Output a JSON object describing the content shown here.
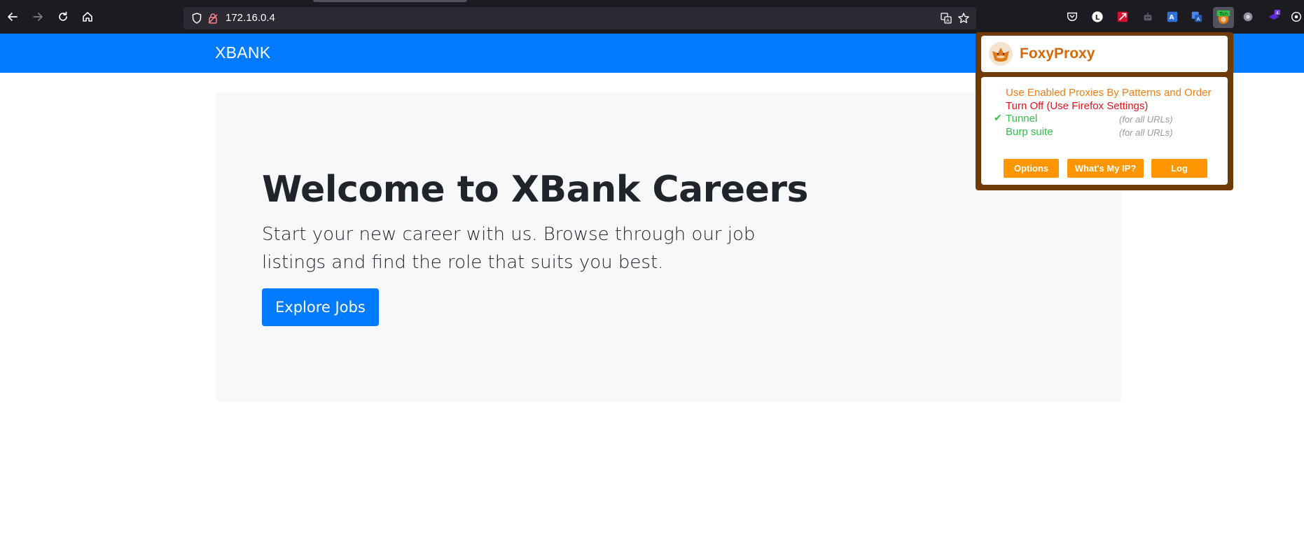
{
  "browser": {
    "url": "172.16.0.4",
    "nav": [
      "back",
      "forward",
      "reload",
      "home"
    ],
    "extension_badges": {
      "foxyproxy": "Tun",
      "notifications": "4"
    },
    "extension_icons": [
      "pocket-icon",
      "l-extension-icon",
      "red-extension-icon",
      "robot-icon",
      "translate-icon",
      "translate-alt-icon",
      "foxyproxy-icon",
      "grey-circle-icon",
      "purple-extension-icon",
      "puzzle-icon"
    ]
  },
  "navbar": {
    "brand": "XBANK"
  },
  "hero": {
    "title": "Welcome to XBank Careers",
    "lead": "Start your new career with us. Browse through our job listings and find the role that suits you best.",
    "button": "Explore Jobs"
  },
  "foxyproxy": {
    "title": "FoxyProxy",
    "options": [
      {
        "label": "Use Enabled Proxies By Patterns and Order",
        "color": "#f07e16"
      },
      {
        "label": "Turn Off (Use Firefox Settings)",
        "color": "#e4141b"
      },
      {
        "label": "Tunnel",
        "note": "(for all URLs)",
        "color": "#31c14a",
        "selected": true,
        "check": "✔"
      },
      {
        "label": "Burp suite",
        "note": "(for all URLs)",
        "color": "#31c14a",
        "selected": false
      }
    ],
    "buttons": [
      "Options",
      "What's My IP?",
      "Log"
    ]
  },
  "colors": {
    "primary": "#007bff",
    "foxy_frame": "#6e3a05",
    "foxy_button": "#ff9500"
  }
}
